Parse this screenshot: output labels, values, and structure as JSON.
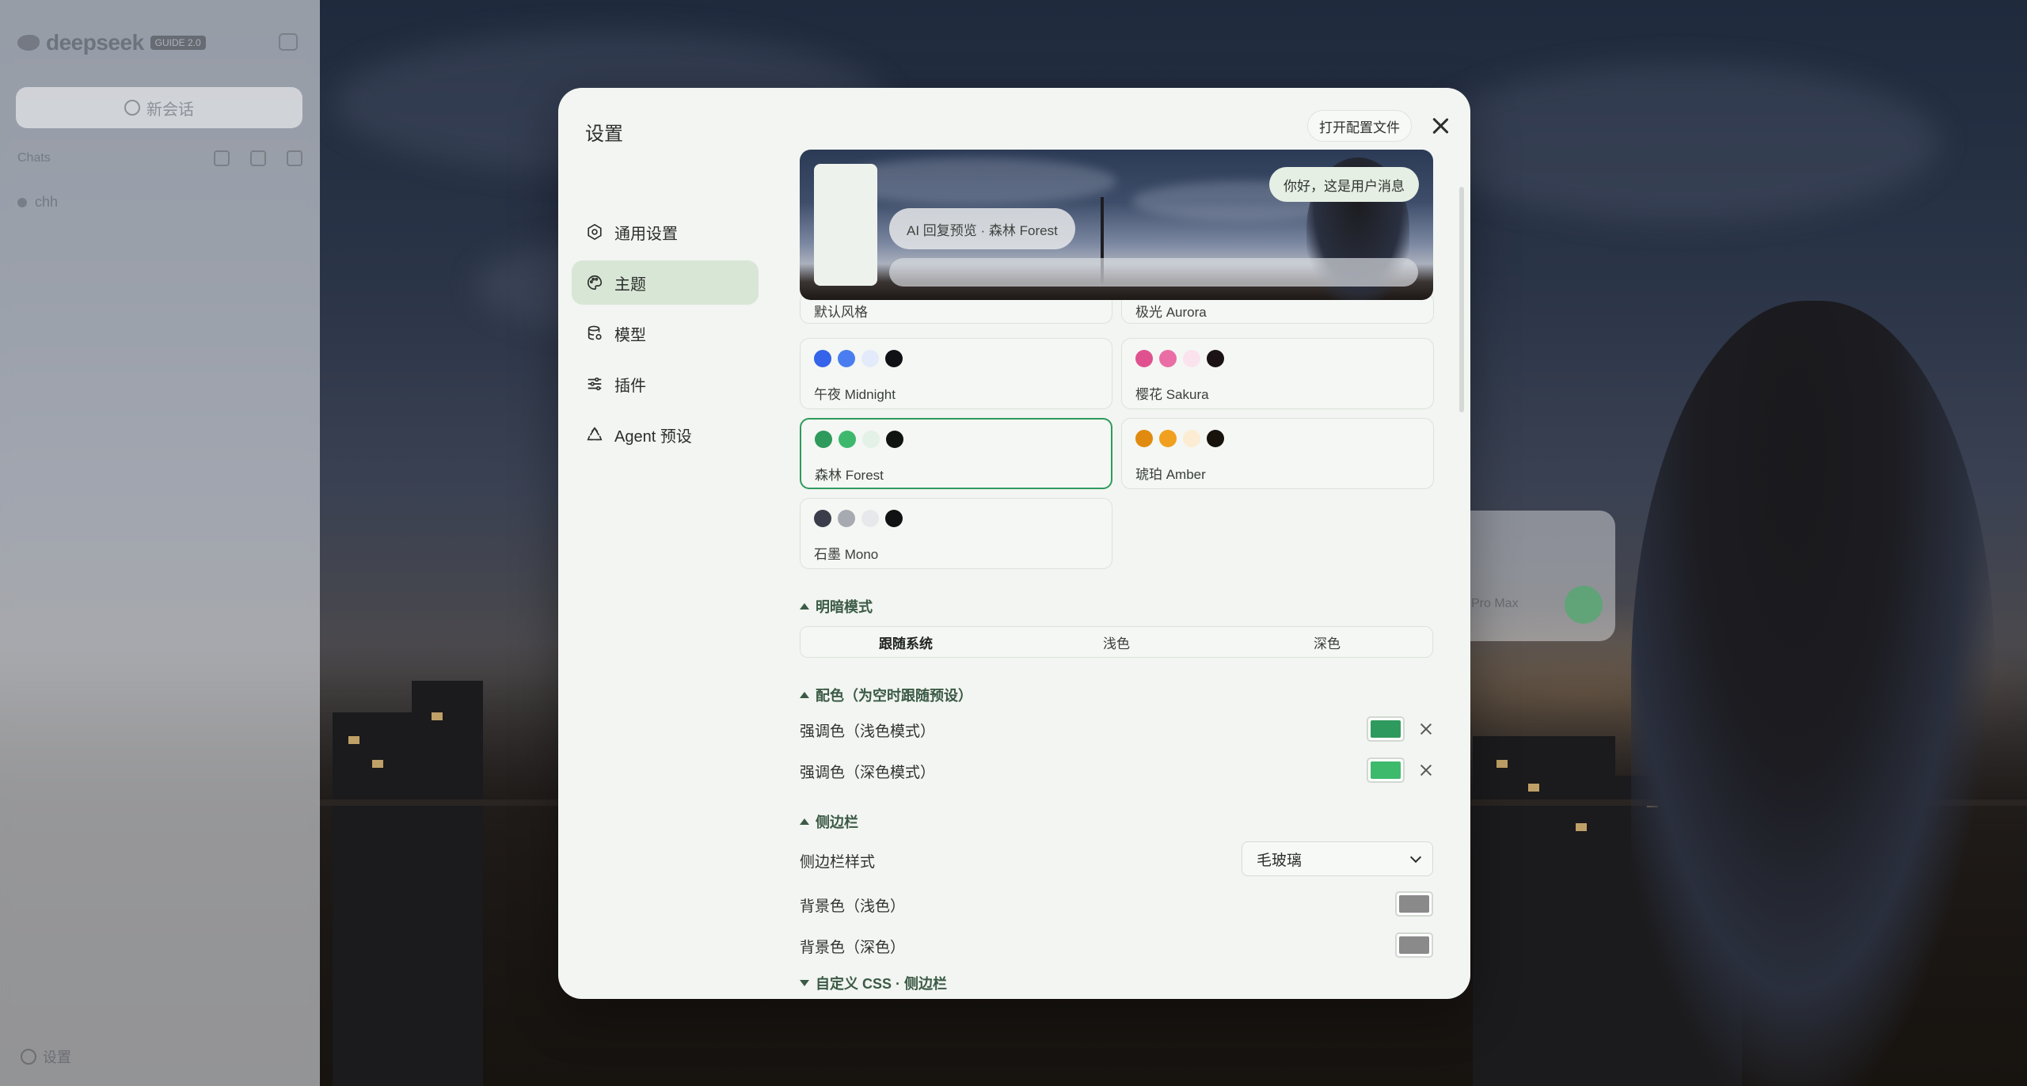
{
  "app": {
    "logo_text": "deepseek",
    "logo_badge": "GUIDE 2.0",
    "new_chat": "新会话",
    "toolbar_label": "Chats",
    "conversation": "chh",
    "settings_link": "设置",
    "model_label": "Pro Max"
  },
  "modal": {
    "title": "设置",
    "open_config": "打开配置文件"
  },
  "nav": [
    {
      "label": "通用设置",
      "icon": "gear-icon"
    },
    {
      "label": "主题",
      "icon": "palette-icon",
      "active": true
    },
    {
      "label": "模型",
      "icon": "database-icon"
    },
    {
      "label": "插件",
      "icon": "sliders-icon"
    },
    {
      "label": "Agent 预设",
      "icon": "recycle-icon"
    }
  ],
  "preview": {
    "ai_bubble": "AI 回复预览 · 森林 Forest",
    "user_bubble": "你好，这是用户消息"
  },
  "themes": [
    {
      "name": "默认风格"
    },
    {
      "name": "极光 Aurora"
    },
    {
      "name": "午夜 Midnight",
      "colors": [
        "#3563e9",
        "#4a7ef0",
        "#e3ebfb",
        "#0f1115"
      ]
    },
    {
      "name": "樱花 Sakura",
      "colors": [
        "#e0528f",
        "#ea6ea5",
        "#fbe3ee",
        "#1a1214"
      ]
    },
    {
      "name": "森林 Forest",
      "colors": [
        "#2e9a5b",
        "#3db86d",
        "#e3f1e6",
        "#101411"
      ],
      "selected": true
    },
    {
      "name": "琥珀 Amber",
      "colors": [
        "#e08a0f",
        "#f0a01e",
        "#fbecd3",
        "#17120c"
      ]
    },
    {
      "name": "石墨 Mono",
      "colors": [
        "#3b3e4a",
        "#a8aab2",
        "#e7e8eb",
        "#111214"
      ]
    }
  ],
  "sections": {
    "mode_title": "明暗模式",
    "mode_options": [
      "跟随系统",
      "浅色",
      "深色"
    ],
    "mode_selected": "跟随系统",
    "color_title": "配色（为空时跟随预设）",
    "accent_light_label": "强调色（浅色模式）",
    "accent_light_color": "#2f9a5d",
    "accent_dark_label": "强调色（深色模式）",
    "accent_dark_color": "#3dba6c",
    "sidebar_title": "侧边栏",
    "sidebar_style_label": "侧边栏样式",
    "sidebar_style_value": "毛玻璃",
    "bg_light_label": "背景色（浅色）",
    "bg_light_color": "#8a8a8a",
    "bg_dark_label": "背景色（深色）",
    "bg_dark_color": "#8a8a8a",
    "custom_css_title": "自定义 CSS · 侧边栏"
  }
}
